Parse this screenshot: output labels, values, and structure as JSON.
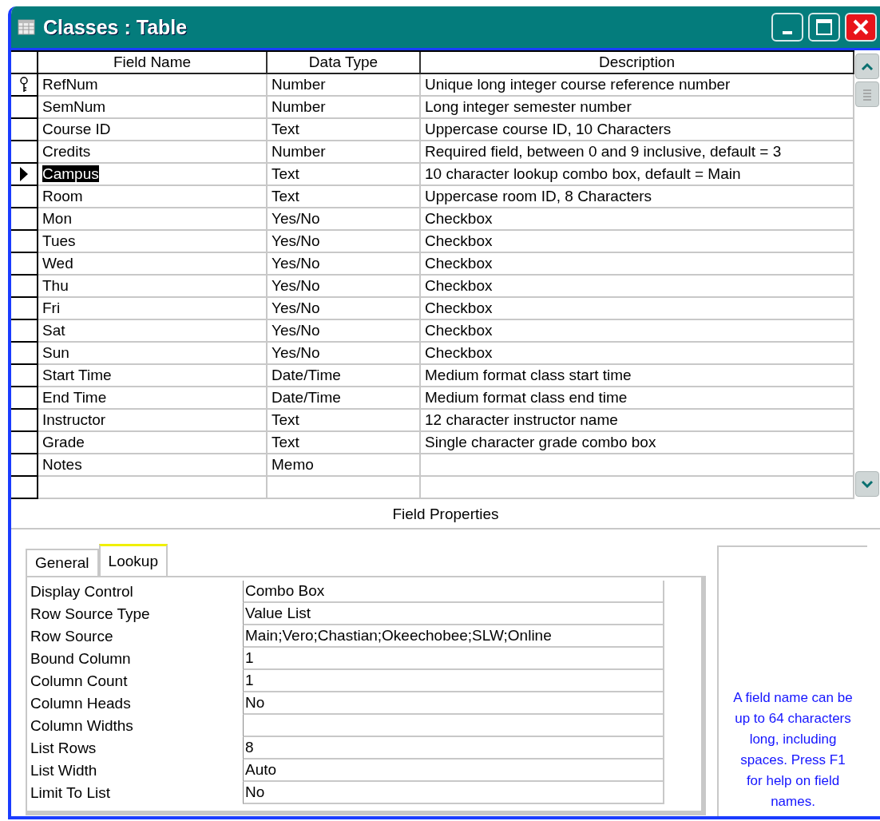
{
  "window": {
    "title": "Classes : Table"
  },
  "columns": [
    "Field Name",
    "Data Type",
    "Description"
  ],
  "fields": [
    {
      "name": "RefNum",
      "type": "Number",
      "description": "Unique long integer course reference number",
      "primary_key": true,
      "selected": false
    },
    {
      "name": "SemNum",
      "type": "Number",
      "description": "Long integer semester number",
      "primary_key": false,
      "selected": false
    },
    {
      "name": "Course ID",
      "type": "Text",
      "description": "Uppercase course ID, 10 Characters",
      "primary_key": false,
      "selected": false
    },
    {
      "name": "Credits",
      "type": "Number",
      "description": "Required field, between 0 and 9 inclusive, default = 3",
      "primary_key": false,
      "selected": false
    },
    {
      "name": "Campus",
      "type": "Text",
      "description": "10 character lookup combo box, default = Main",
      "primary_key": false,
      "selected": true
    },
    {
      "name": "Room",
      "type": "Text",
      "description": "Uppercase room ID, 8 Characters",
      "primary_key": false,
      "selected": false
    },
    {
      "name": "Mon",
      "type": "Yes/No",
      "description": "Checkbox",
      "primary_key": false,
      "selected": false
    },
    {
      "name": "Tues",
      "type": "Yes/No",
      "description": "Checkbox",
      "primary_key": false,
      "selected": false
    },
    {
      "name": "Wed",
      "type": "Yes/No",
      "description": "Checkbox",
      "primary_key": false,
      "selected": false
    },
    {
      "name": "Thu",
      "type": "Yes/No",
      "description": "Checkbox",
      "primary_key": false,
      "selected": false
    },
    {
      "name": "Fri",
      "type": "Yes/No",
      "description": "Checkbox",
      "primary_key": false,
      "selected": false
    },
    {
      "name": "Sat",
      "type": "Yes/No",
      "description": "Checkbox",
      "primary_key": false,
      "selected": false
    },
    {
      "name": "Sun",
      "type": "Yes/No",
      "description": "Checkbox",
      "primary_key": false,
      "selected": false
    },
    {
      "name": "Start Time",
      "type": "Date/Time",
      "description": "Medium format class start time",
      "primary_key": false,
      "selected": false
    },
    {
      "name": "End Time",
      "type": "Date/Time",
      "description": "Medium format class end time",
      "primary_key": false,
      "selected": false
    },
    {
      "name": "Instructor",
      "type": "Text",
      "description": "12 character instructor name",
      "primary_key": false,
      "selected": false
    },
    {
      "name": "Grade",
      "type": "Text",
      "description": "Single character grade combo box",
      "primary_key": false,
      "selected": false
    },
    {
      "name": "Notes",
      "type": "Memo",
      "primary_key": false,
      "selected": false
    }
  ],
  "section_title": "Field Properties",
  "tabs": [
    {
      "label": "General",
      "selected": false
    },
    {
      "label": "Lookup",
      "selected": true
    }
  ],
  "properties": [
    {
      "label": "Display Control",
      "value": "Combo Box"
    },
    {
      "label": "Row Source Type",
      "value": "Value List"
    },
    {
      "label": "Row Source",
      "value": "Main;Vero;Chastian;Okeechobee;SLW;Online"
    },
    {
      "label": "Bound Column",
      "value": "1"
    },
    {
      "label": "Column Count",
      "value": "1"
    },
    {
      "label": "Column Heads",
      "value": "No"
    },
    {
      "label": "Column Widths"
    },
    {
      "label": "List Rows",
      "value": "8"
    },
    {
      "label": "List Width",
      "value": "Auto"
    },
    {
      "label": "Limit To List",
      "value": "No"
    }
  ],
  "help_text": "A field name can be up to 64 characters long, including spaces.  Press F1 for help on field names."
}
